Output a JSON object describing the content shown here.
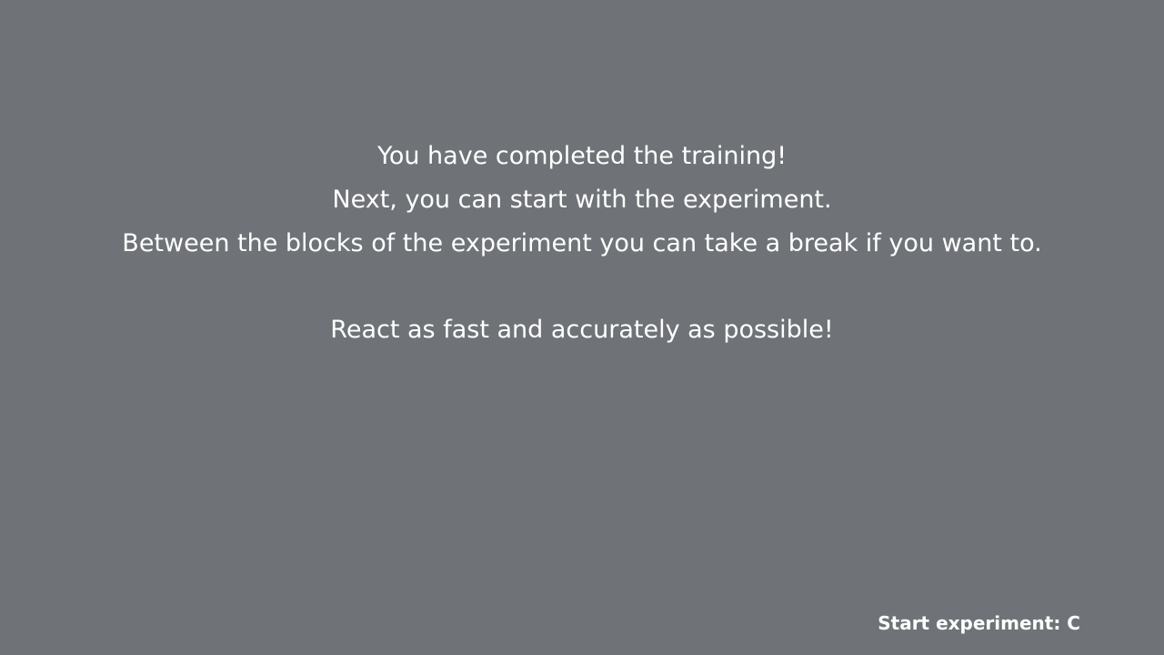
{
  "instructions": {
    "lines": [
      "You have completed the training!",
      "Next, you can start with the experiment.",
      "Between the blocks of the experiment you can take a break if you want to."
    ],
    "emphasis": "React as fast and accurately as possible!"
  },
  "controls": {
    "start_prompt": "Start experiment: C"
  },
  "colors": {
    "background": "#6f7377",
    "text": "#ffffff"
  }
}
